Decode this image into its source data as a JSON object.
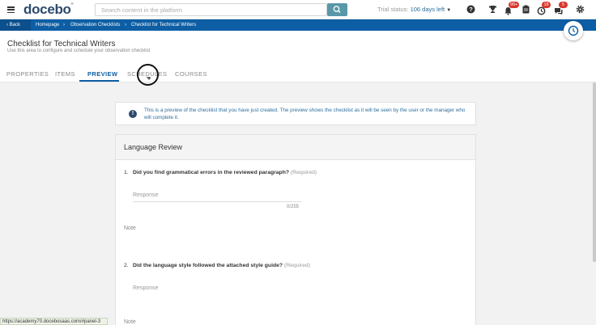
{
  "topbar": {
    "logo": "docebo",
    "logo_mark": "®",
    "search_placeholder": "Search content in the platform",
    "trial_label": "Trial status:",
    "trial_value": "106 days left",
    "badges": {
      "notifications": "99+",
      "courses": "18",
      "messages": "5"
    }
  },
  "breadcrumb": {
    "back": "Back",
    "items": [
      "Homepage",
      "Observation Checklists",
      "Checklist for Technical Writers"
    ]
  },
  "header": {
    "title": "Checklist for Technical Writers",
    "subtitle": "Use this area to configure and schedule your observation checklist",
    "tabs": [
      "PROPERTIES",
      "ITEMS",
      "PREVIEW",
      "SCHEDULES",
      "COURSES"
    ],
    "active_tab": "PREVIEW"
  },
  "info": {
    "icon": "!",
    "text": "This is a preview of the checklist that you have just created. The preview shows the checklist as it will be seen by the user or the manager who will complete it."
  },
  "card": {
    "title": "Language Review",
    "questions": [
      {
        "num": "1.",
        "text": "Did you find grammatical errors in the reviewed paragraph?",
        "required": "(Required)",
        "response_placeholder": "Response",
        "counter": "0/255",
        "note_label": "Note"
      },
      {
        "num": "2.",
        "text": "Did the language style followed the attached style guide?",
        "required": "(Required)",
        "response_placeholder": "Response",
        "note_label": "Note"
      }
    ]
  },
  "statusbar": {
    "url": "https://academy70.docebosaas.com/#panel-3"
  },
  "colors": {
    "brand_blue": "#0d5ea4",
    "logo_navy": "#2c4a6e",
    "search_teal": "#5898a8",
    "badge_red": "#d9372b"
  }
}
